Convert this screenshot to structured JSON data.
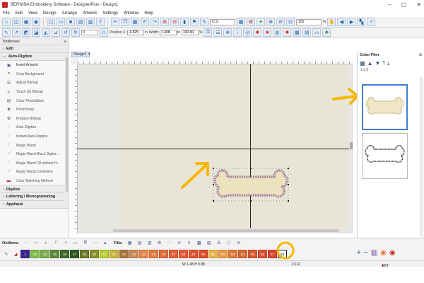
{
  "window": {
    "title": "BERNINA Embroidery Software - DesignerPlus - Design1",
    "controls": [
      "–",
      "▢",
      "✕"
    ]
  },
  "menu": [
    "File",
    "Edit",
    "View",
    "Design",
    "Arrange",
    "Artwork",
    "Settings",
    "Window",
    "Help"
  ],
  "toolbar": {
    "position_x_label": "Position X:",
    "position_x_value": "-0.825",
    "position_y_label": "Position Y:",
    "position_y_value": "0.694",
    "width_label": "Width:",
    "width_value": "1.408",
    "height_label": "Height:",
    "height_value": "0.806",
    "unit": "in",
    "scale_w": "100.00",
    "scale_h": "100.00",
    "percent": "%",
    "rotate_value": "0",
    "zoom_value": "155",
    "fabric_value": "U.S."
  },
  "tools_panel": {
    "title": "Toolboxes",
    "sections": [
      {
        "name": "Edit",
        "expanded": false
      },
      {
        "name": "Auto-Digitize",
        "expanded": true
      }
    ],
    "items": [
      {
        "label": "Insert Artwork",
        "icon": "insert-artwork-icon"
      },
      {
        "label": "Crop Background",
        "icon": "crop-icon"
      },
      {
        "label": "Adjust Bitmap",
        "icon": "adjust-icon"
      },
      {
        "label": "Touch Up Bitmap",
        "icon": "brush-icon"
      },
      {
        "label": "Color PhotoStitch",
        "icon": "photo-icon"
      },
      {
        "label": "PhotoSnap",
        "icon": "camera-icon"
      },
      {
        "label": "Prepare Bitmap",
        "icon": "palette-icon"
      },
      {
        "label": "Auto-Digitize",
        "icon": "wand-icon"
      },
      {
        "label": "Instant Auto-Digitize",
        "icon": "wand-icon"
      },
      {
        "label": "Magic Wand",
        "icon": "wand-icon"
      },
      {
        "label": "Magic Wand Block Digitiz...",
        "icon": "wand-icon"
      },
      {
        "label": "Magic Wand Fill without H...",
        "icon": "wand-icon"
      },
      {
        "label": "Magic Wand Centerline",
        "icon": "wand-icon"
      },
      {
        "label": "Color Matching Method",
        "icon": "color-match-icon"
      }
    ],
    "bottom_sections": [
      "Digitize",
      "Lettering / Monogramming",
      "Appliqué"
    ]
  },
  "document": {
    "tab_label": "Design1",
    "tab_close": "✕"
  },
  "color_film": {
    "title": "Color Film",
    "zoom_label": "1:2.5"
  },
  "bottom": {
    "outlines_label": "Outlines:",
    "fills_label": "Fills:",
    "swatches": [
      {
        "n": "1",
        "color": "#3a2a8c"
      },
      {
        "n": "33",
        "color": "#7bbf4a"
      },
      {
        "n": "34",
        "color": "#7fae52"
      },
      {
        "n": "35",
        "color": "#5e8c3a"
      },
      {
        "n": "36",
        "color": "#3d6b2a"
      },
      {
        "n": "37",
        "color": "#2f5a23"
      },
      {
        "n": "38",
        "color": "#6f7a2a"
      },
      {
        "n": "39",
        "color": "#8a8f2c"
      },
      {
        "n": "40",
        "color": "#b8cc2e"
      },
      {
        "n": "41",
        "color": "#c9b53c"
      },
      {
        "n": "42",
        "color": "#a8743c"
      },
      {
        "n": "43",
        "color": "#c98a52"
      },
      {
        "n": "44",
        "color": "#e8854a"
      },
      {
        "n": "45",
        "color": "#e77a3e"
      },
      {
        "n": "46",
        "color": "#e56d3d"
      },
      {
        "n": "47",
        "color": "#e85e3d"
      },
      {
        "n": "48",
        "color": "#ea5a36"
      },
      {
        "n": "49",
        "color": "#e4522f"
      },
      {
        "n": "50",
        "color": "#e04b2c"
      },
      {
        "n": "51",
        "color": "#e8b54a"
      },
      {
        "n": "52",
        "color": "#e99c47"
      },
      {
        "n": "53",
        "color": "#e07b3d"
      },
      {
        "n": "54",
        "color": "#d96a35"
      },
      {
        "n": "55",
        "color": "#d85a35"
      },
      {
        "n": "56",
        "color": "#de4f33"
      },
      {
        "n": "57",
        "color": "#d94732"
      },
      {
        "n": "58",
        "color": "#f2f2f2"
      }
    ],
    "selected_swatch": "58"
  },
  "status": {
    "size": "W 1.48 H 0.88",
    "zoom": "1:312",
    "grade": "ART Grade: A"
  },
  "annotation_color": "#f5b800"
}
